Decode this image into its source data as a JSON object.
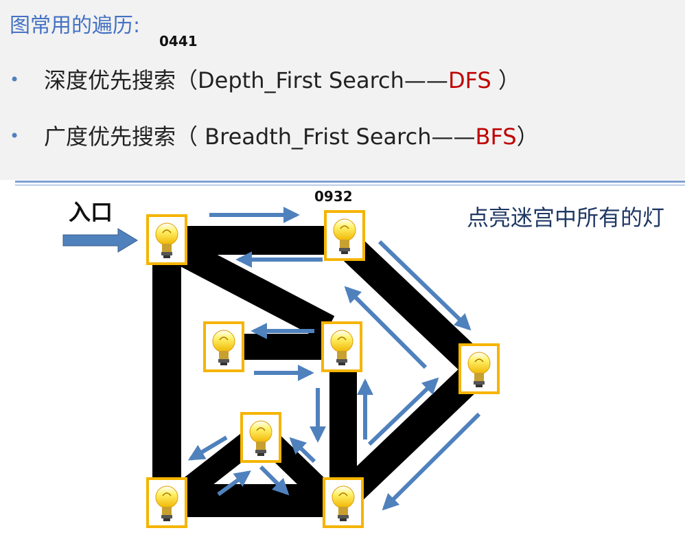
{
  "title": "图常用的遍历:",
  "code_a": "0441",
  "code_b": "0932",
  "bullet_glyph": "•",
  "dfs": {
    "prefix": "深度优先搜索（Depth_First Search——",
    "abbr": "DFS",
    "suffix": " ）"
  },
  "bfs": {
    "prefix": "广度优先搜索（ Breadth_Frist Search——",
    "abbr": "BFS",
    "suffix": "）"
  },
  "entry_label": "入口",
  "task_label": "点亮迷宫中所有的灯",
  "colors": {
    "title": "#4472c4",
    "accent_red": "#c00000",
    "arrow_blue": "#4f81bd",
    "maze": "#000000",
    "bulb_border": "#f5b400"
  },
  "icons": {
    "bulb": "light-bulb-icon",
    "arrow": "arrow-icon"
  }
}
